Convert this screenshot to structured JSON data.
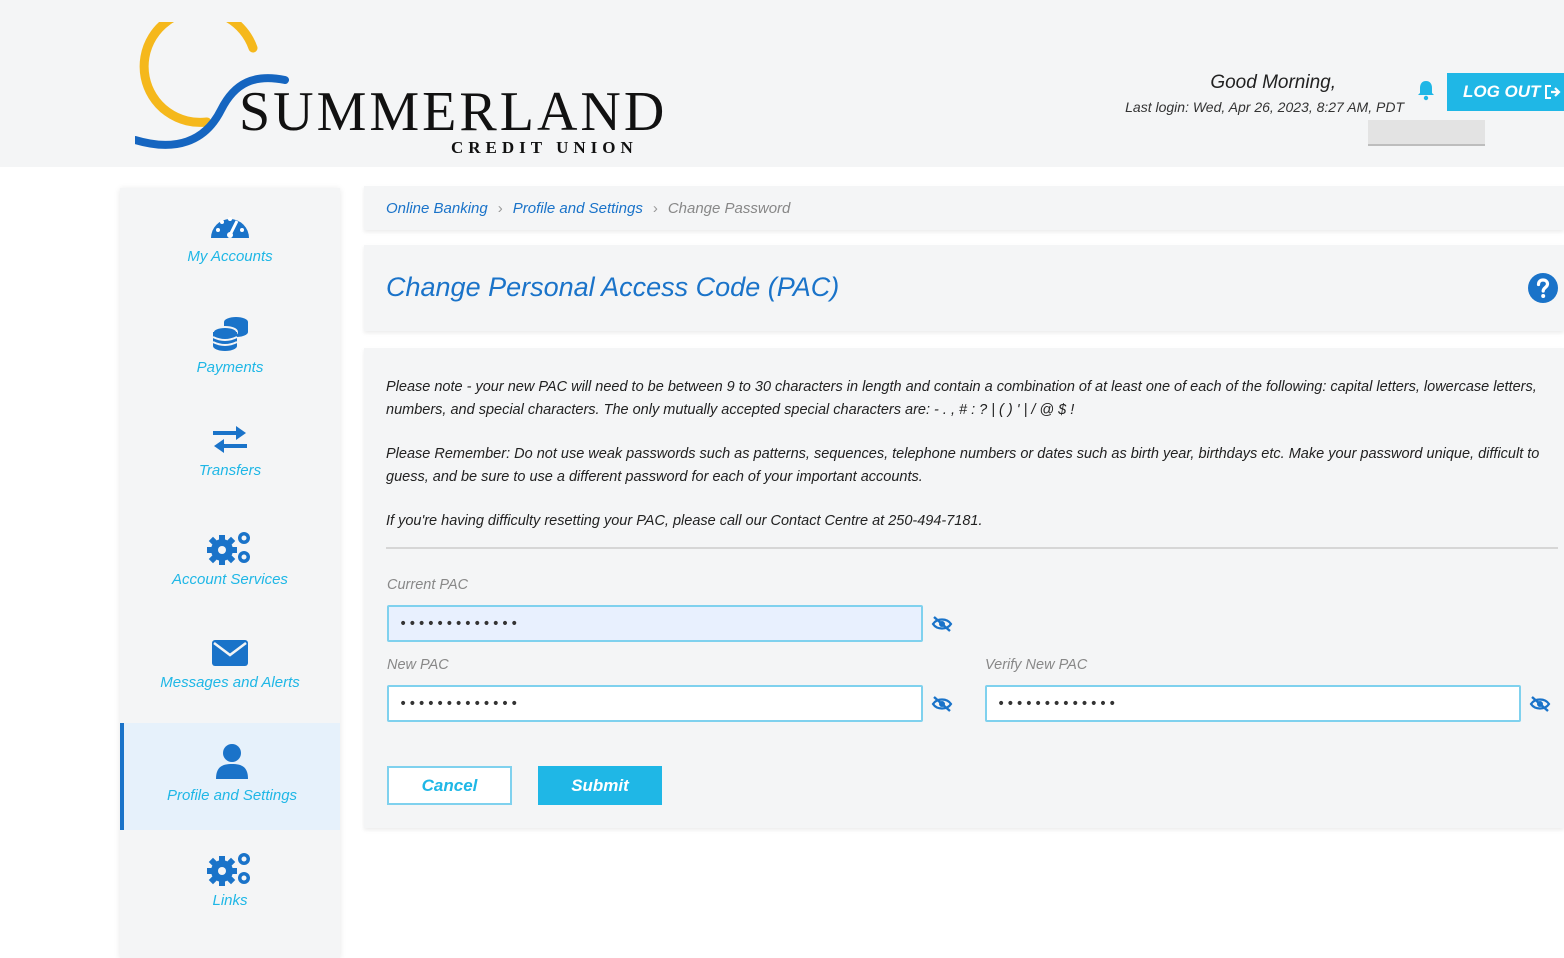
{
  "header": {
    "brand_name": "SUMMERLAND",
    "brand_sub": "CREDIT UNION",
    "greeting": "Good Morning,",
    "last_login": "Last login: Wed, Apr 26, 2023, 8:27 AM, PDT",
    "logout_label": "LOG OUT",
    "logout_icon": "sign-out-icon",
    "bell_icon": "bell-icon"
  },
  "sidebar": {
    "items": [
      {
        "label": "My Accounts",
        "icon": "dashboard-icon"
      },
      {
        "label": "Payments",
        "icon": "coins-icon"
      },
      {
        "label": "Transfers",
        "icon": "exchange-arrows-icon"
      },
      {
        "label": "Account Services",
        "icon": "gears-icon"
      },
      {
        "label": "Messages and Alerts",
        "icon": "envelope-icon"
      },
      {
        "label": "Profile and Settings",
        "icon": "user-icon",
        "active": true
      },
      {
        "label": "Links",
        "icon": "gears-icon"
      }
    ]
  },
  "breadcrumb": {
    "items": [
      "Online Banking",
      "Profile and Settings",
      "Change Password"
    ]
  },
  "page": {
    "title": "Change Personal Access Code (PAC)",
    "help_icon": "question-circle-icon"
  },
  "notes": {
    "requirements": "Please note - your new PAC will need to be between 9 to 30 characters in length and contain a combination of at least one of each of the following: capital letters, lowercase letters, numbers, and special characters. The only mutually accepted special characters are: - . , # : ? | ( ) ' | / @ $ !",
    "remember": "Please Remember: Do not use weak passwords such as patterns, sequences, telephone numbers or dates such as birth year, birthdays etc. Make your password unique, difficult to guess, and be sure to use a different password for each of your important accounts.",
    "contact": "If you're having difficulty resetting your PAC, please call our Contact Centre at 250-494-7181."
  },
  "form": {
    "current_label": "Current PAC",
    "current_value": "•••••••••••••",
    "new_label": "New PAC",
    "new_value": "•••••••••••••",
    "verify_label": "Verify New PAC",
    "verify_value": "•••••••••••••",
    "eye_icon": "eye-slash-icon",
    "cancel_label": "Cancel",
    "submit_label": "Submit"
  },
  "colors": {
    "accent": "#1fb7e6",
    "link": "#1a73c9",
    "logo_yellow": "#f5b81c",
    "logo_blue": "#1565c0"
  }
}
